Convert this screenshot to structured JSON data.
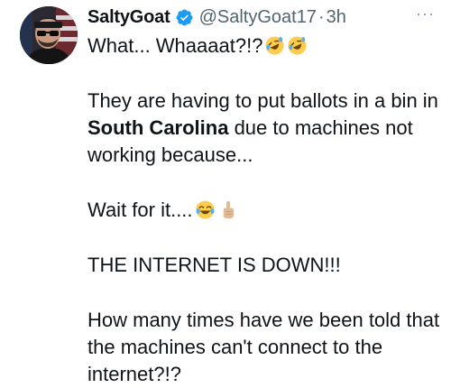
{
  "author": {
    "display_name": "SaltyGoat",
    "handle": "@SaltyGoat17",
    "separator": "·",
    "time": "3h",
    "verified": true,
    "avatar": "man-with-sunglasses-and-flag"
  },
  "more_icon": "more-horizontal-icon",
  "more_label": "···",
  "tweet": {
    "line1": "What... Whaaaat?!?",
    "p2_pre": "They are having to put ballots in a bin in ",
    "p2_bold": "South Carolina",
    "p2_post": " due to machines not working because...",
    "p3": "Wait for it....",
    "p4": "THE INTERNET IS DOWN!!!",
    "p5": "How many times have we been told that the machines can't connect to the internet?!?"
  },
  "emojis": [
    "rolling-on-floor-laughing",
    "rolling-on-floor-laughing",
    "face-with-tears-of-joy",
    "index-pointing-up"
  ],
  "colors": {
    "verified_badge": "#1d9bf0",
    "secondary_text": "#536471"
  }
}
